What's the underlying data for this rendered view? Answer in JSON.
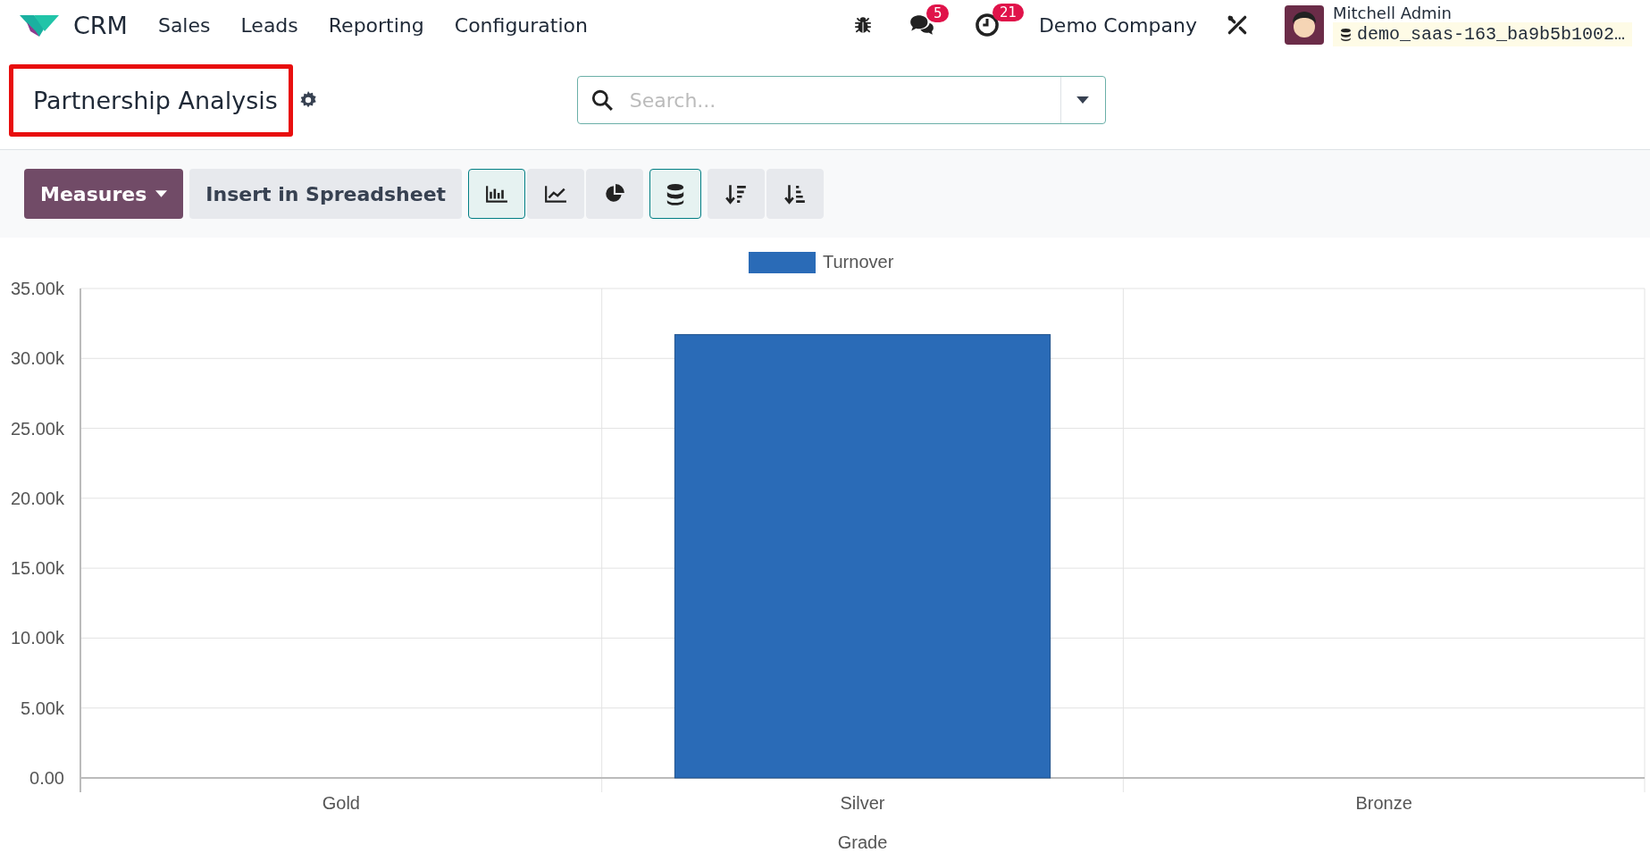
{
  "navbar": {
    "app_name": "CRM",
    "menu": [
      "Sales",
      "Leads",
      "Reporting",
      "Configuration"
    ],
    "messages_count": "5",
    "activities_count": "21",
    "company": "Demo Company",
    "user_name": "Mitchell Admin",
    "database": "demo_saas-163_ba9b5b1002…"
  },
  "control_panel": {
    "title": "Partnership Analysis",
    "search": {
      "placeholder": "Search..."
    },
    "measures_button": "Measures",
    "insert_button": "Insert in Spreadsheet",
    "chart_types": [
      {
        "kind": "bar",
        "selected": true
      },
      {
        "kind": "line",
        "selected": false
      },
      {
        "kind": "pie",
        "selected": false
      }
    ],
    "stacked": true
  },
  "chart_data": {
    "type": "bar",
    "xlabel": "Grade",
    "categories": [
      "Gold",
      "Silver",
      "Bronze"
    ],
    "series": [
      {
        "name": "Turnover",
        "color": "#2a6bb7",
        "values": [
          0,
          31700,
          0
        ]
      }
    ],
    "ylim": [
      0,
      35000
    ],
    "grid": true,
    "yticks": [
      {
        "value": 0,
        "label": "0.00"
      },
      {
        "value": 5000,
        "label": "5.00k"
      },
      {
        "value": 10000,
        "label": "10.00k"
      },
      {
        "value": 15000,
        "label": "15.00k"
      },
      {
        "value": 20000,
        "label": "20.00k"
      },
      {
        "value": 25000,
        "label": "25.00k"
      },
      {
        "value": 30000,
        "label": "30.00k"
      },
      {
        "value": 35000,
        "label": "35.00k"
      }
    ]
  }
}
